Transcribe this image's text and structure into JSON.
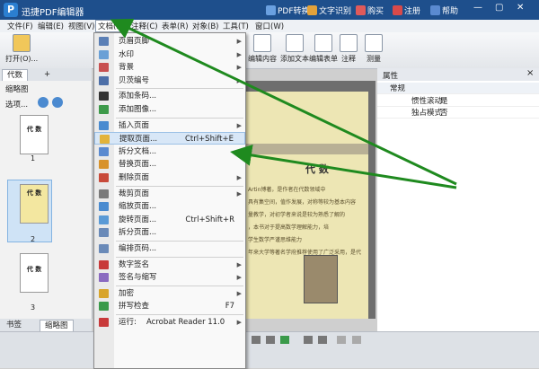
{
  "app": {
    "title": "迅捷PDF编辑器",
    "logo_letter": "P"
  },
  "title_buttons": [
    {
      "label": "PDF转换",
      "color": "#6aa0e0"
    },
    {
      "label": "文字识别",
      "color": "#e3a23a"
    },
    {
      "label": "购买",
      "color": "#e05a5a"
    },
    {
      "label": "注册",
      "color": "#d94a4a"
    },
    {
      "label": "帮助",
      "color": "#5a8ad0"
    }
  ],
  "menubar": [
    "文件(F)",
    "编辑(E)",
    "视图(V)",
    "文档(D)",
    "注释(C)",
    "表单(R)",
    "对象(B)",
    "工具(T)",
    "窗口(W)"
  ],
  "toolbar": {
    "open_label": "打开(O)...",
    "tools": [
      "编辑内容",
      "添加文本",
      "编辑表单",
      "注释",
      "测量"
    ]
  },
  "left_panel": {
    "tab_label": "代数",
    "add_tab": "+",
    "header": "缩略图",
    "options_label": "选项...",
    "page_numbers": [
      "1",
      "2",
      "3"
    ],
    "thumb_text": "代 数",
    "bottom_tabs": [
      "书签",
      "缩略图"
    ]
  },
  "document": {
    "heading": "代 数",
    "lines": [
      "Artin博著，是作者在代数领域中",
      "具有集空间，值作发展，对称等较为基本内容",
      "量教学，对初学者来说是较为熟悉了解的",
      "，本书对于提高数学理解能力，培",
      "学生数学严谨思维能力",
      "年来大学等著名学府推荐使用了广泛采用，是代"
    ]
  },
  "properties": {
    "title": "属性",
    "section": "常规",
    "rows": [
      {
        "key": "惯性滚动",
        "value": "是"
      },
      {
        "key": "独占模式",
        "value": "否"
      }
    ]
  },
  "doc_menu": {
    "items": [
      {
        "label": "页眉页脚",
        "arrow": true,
        "icon": "#5b7fb5"
      },
      {
        "label": "水印",
        "arrow": true,
        "icon": "#6aa0d6"
      },
      {
        "label": "背景",
        "arrow": true,
        "icon": "#c85050"
      },
      {
        "label": "贝茨编号",
        "arrow": true,
        "icon": "#4d6fa8"
      },
      {
        "sep": true
      },
      {
        "label": "添加条码...",
        "icon": "#333333"
      },
      {
        "label": "添加图像...",
        "icon": "#3d9a4a"
      },
      {
        "sep": true
      },
      {
        "label": "插入页面",
        "arrow": true,
        "icon": "#4a8bd0"
      },
      {
        "label": "提取页面...",
        "shortcut": "Ctrl+Shift+E",
        "icon": "#e3b33a",
        "highlight": true
      },
      {
        "label": "拆分文档...",
        "icon": "#5a8ad0"
      },
      {
        "label": "替换页面...",
        "icon": "#d8932c"
      },
      {
        "label": "删除页面",
        "arrow": true,
        "icon": "#c84a3a"
      },
      {
        "sep": true
      },
      {
        "label": "裁剪页面",
        "arrow": true,
        "icon": "#7a7a7a"
      },
      {
        "label": "缩放页面...",
        "icon": "#4a8bd0"
      },
      {
        "label": "旋转页面...",
        "shortcut": "Ctrl+Shift+R",
        "icon": "#5a9ad6"
      },
      {
        "label": "拆分页面...",
        "icon": "#6a8ab8"
      },
      {
        "sep": true
      },
      {
        "label": "编排页码...",
        "icon": "#6a8ab8"
      },
      {
        "sep": true
      },
      {
        "label": "数字签名",
        "arrow": true,
        "icon": "#c83a3a"
      },
      {
        "label": "签名与缩写",
        "arrow": true,
        "icon": "#8a6ac0"
      },
      {
        "sep": true
      },
      {
        "label": "加密",
        "arrow": true,
        "icon": "#d8a52c"
      },
      {
        "label": "拼写检查",
        "shortcut": "F7",
        "icon": "#3a9a4a"
      },
      {
        "sep": true
      },
      {
        "label": "运行:",
        "extra": "Acrobat Reader 11.0",
        "arrow": true,
        "icon": "#c83a3a"
      }
    ]
  },
  "colors": {
    "accent": "#1e4f8c",
    "arrow": "#1f8a1f",
    "highlight": "#d8e7f7"
  }
}
